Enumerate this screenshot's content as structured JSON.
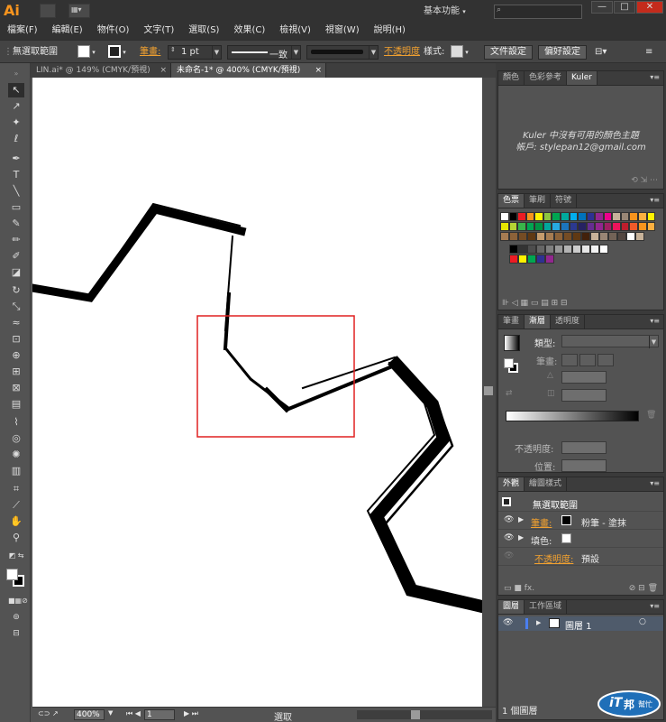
{
  "app": {
    "logo": "Ai"
  },
  "titlebar": {
    "workspace_label": "基本功能",
    "search_placeholder": "",
    "window_controls": [
      "—",
      "□",
      "✕"
    ]
  },
  "menubar": {
    "items": [
      "檔案(F)",
      "編輯(E)",
      "物件(O)",
      "文字(T)",
      "選取(S)",
      "效果(C)",
      "檢視(V)",
      "視窗(W)",
      "說明(H)"
    ]
  },
  "controlbar": {
    "selection_label": "無選取範圍",
    "stroke_label": "筆畫:",
    "stroke_weight": "1 pt",
    "profile_label": "一致",
    "opacity_label": "不透明度",
    "style_label": "樣式:",
    "doc_setup_button": "文件設定",
    "prefs_button": "偏好設定"
  },
  "tabs": [
    {
      "label": "LIN.ai* @ 149% (CMYK/預視)",
      "close": "×"
    },
    {
      "label": "未命名-1* @ 400% (CMYK/預視)",
      "close": "×"
    }
  ],
  "statusbar": {
    "zoom": "400%",
    "page": "1",
    "status_text": "選取"
  },
  "kuler_panel": {
    "tabs": [
      "顏色",
      "色彩參考",
      "Kuler"
    ],
    "message_line1": "Kuler 中沒有可用的顏色主題",
    "message_line2": "帳戶: stylepan12@gmail.com"
  },
  "swatches_panel": {
    "tabs": [
      "色票",
      "筆刷",
      "符號"
    ],
    "row1": [
      "#ffffff",
      "#000000",
      "#ed1c24",
      "#f7941d",
      "#fff200",
      "#8dc63f",
      "#00a651",
      "#00a99d",
      "#00aeef",
      "#0072bc",
      "#2e3192",
      "#92278f",
      "#ec008c",
      "#c7b299",
      "#998675",
      "#f7941d",
      "#fbb040",
      "#fff200"
    ],
    "row2": [
      "#e6e600",
      "#b5d334",
      "#39b54a",
      "#00a651",
      "#009444",
      "#00a79d",
      "#27aae1",
      "#1c75bc",
      "#2b3990",
      "#262262",
      "#662d91",
      "#92278f",
      "#9e1f63",
      "#ed145b",
      "#be1e2d",
      "#f15a29",
      "#f7941d",
      "#fbb040"
    ],
    "row3": [
      "#a67c52",
      "#8c6239",
      "#754c24",
      "#603913",
      "#c69c6d",
      "#a67c52",
      "#8c6239",
      "#754c24",
      "#603913",
      "#42210b",
      "#c7b299",
      "#998675",
      "#736357",
      "#534741",
      "#ffffff",
      "#c7b299"
    ],
    "gray_row": [
      "#000000",
      "#333333",
      "#4d4d4d",
      "#666666",
      "#808080",
      "#999999",
      "#b3b3b3",
      "#cccccc",
      "#e6e6e6",
      "#f2f2f2",
      "#ffffff"
    ],
    "bright_row": [
      "#ed1c24",
      "#fff200",
      "#00a651",
      "#2e3192",
      "#92278f"
    ]
  },
  "gradient_panel": {
    "tabs": [
      "筆畫",
      "漸層",
      "透明度"
    ],
    "type_label": "類型:",
    "stroke_label": "筆畫:",
    "opacity_label": "不透明度:",
    "position_label": "位置:"
  },
  "appearance_panel": {
    "tabs": [
      "外觀",
      "繪圖樣式"
    ],
    "header": "無選取範圍",
    "stroke_label": "筆畫:",
    "stroke_value": "粉筆 - 塗抹",
    "fill_label": "填色:",
    "opacity_label": "不透明度:",
    "opacity_value": "預設",
    "fx_label": "fx."
  },
  "layers_panel": {
    "tabs": [
      "圖層",
      "工作區域"
    ],
    "layer_name": "圖層 1",
    "footer": "1 個圖層"
  },
  "watermark": {
    "it": "iT",
    "bang": "邦",
    "help": "幫忙"
  }
}
